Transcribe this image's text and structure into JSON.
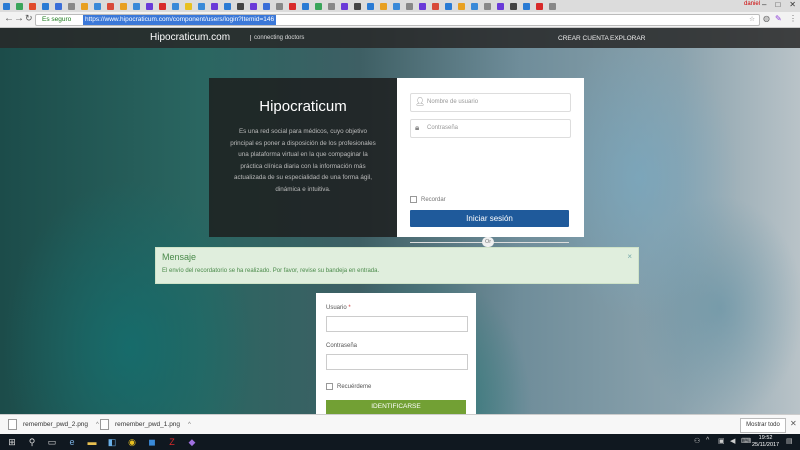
{
  "browser": {
    "tab_icon_colors": [
      "#2a7bd4",
      "#3aa55a",
      "#e04a2a",
      "#2a7bd4",
      "#3a6ed8",
      "#888888",
      "#e8a020",
      "#3a8ad8",
      "#d84a3a",
      "#e8a020",
      "#3a8ad8",
      "#6a3ad8",
      "#d82a2a",
      "#3a8ad8",
      "#e8c020",
      "#3a8ad8",
      "#6a3ad8",
      "#2a7bd4",
      "#444444",
      "#6a3ad8",
      "#3a6ed8",
      "#888888",
      "#d82a2a",
      "#2a7bd4",
      "#3aa55a",
      "#888888",
      "#6a3ad8",
      "#444444",
      "#2a7bd4",
      "#e8a020",
      "#3a8ad8",
      "#888888",
      "#6a3ad8",
      "#d84a3a",
      "#2a7bd4",
      "#e8a020",
      "#3a8ad8",
      "#888888",
      "#6a3ad8",
      "#444444",
      "#2a7bd4",
      "#d82a2a",
      "#888888"
    ],
    "profile_name": "daniel",
    "secure_label": "Es seguro",
    "url": "https://www.hipocraticum.com/component/users/login?Itemid=146"
  },
  "site": {
    "brand": "Hipocraticum.com",
    "tagline": "connecting doctors",
    "nav": [
      "CREAR CUENTA",
      "EXPLORAR"
    ]
  },
  "intro": {
    "title": "Hipocraticum",
    "text": "Es una red social para médicos, cuyo objetivo principal es poner a disposición de los profesionales una plataforma virtual en la que compaginar la práctica clínica diaria con la información más actualizada de su especialidad de una forma ágil, dinámica e intuitiva."
  },
  "login": {
    "username_placeholder": "Nombre de usuario",
    "password_placeholder": "Contraseña",
    "remember_label": "Recordar",
    "submit_label": "Iniciar sesión",
    "or_label": "Or"
  },
  "message": {
    "title": "Mensaje",
    "text": "El envío del recordatorio se ha realizado. Por favor, revise su bandeja en entrada.",
    "close": "×"
  },
  "remind": {
    "user_label": "Usuario",
    "required_mark": "*",
    "password_label": "Contraseña",
    "remember_label": "Recuérdeme",
    "submit_label": "IDENTIFICARSE"
  },
  "downloads": {
    "items": [
      "remember_pwd_2.png",
      "remember_pwd_1.png"
    ],
    "show_all": "Mostrar todo"
  },
  "taskbar": {
    "time": "19:52",
    "date": "25/11/2017"
  }
}
